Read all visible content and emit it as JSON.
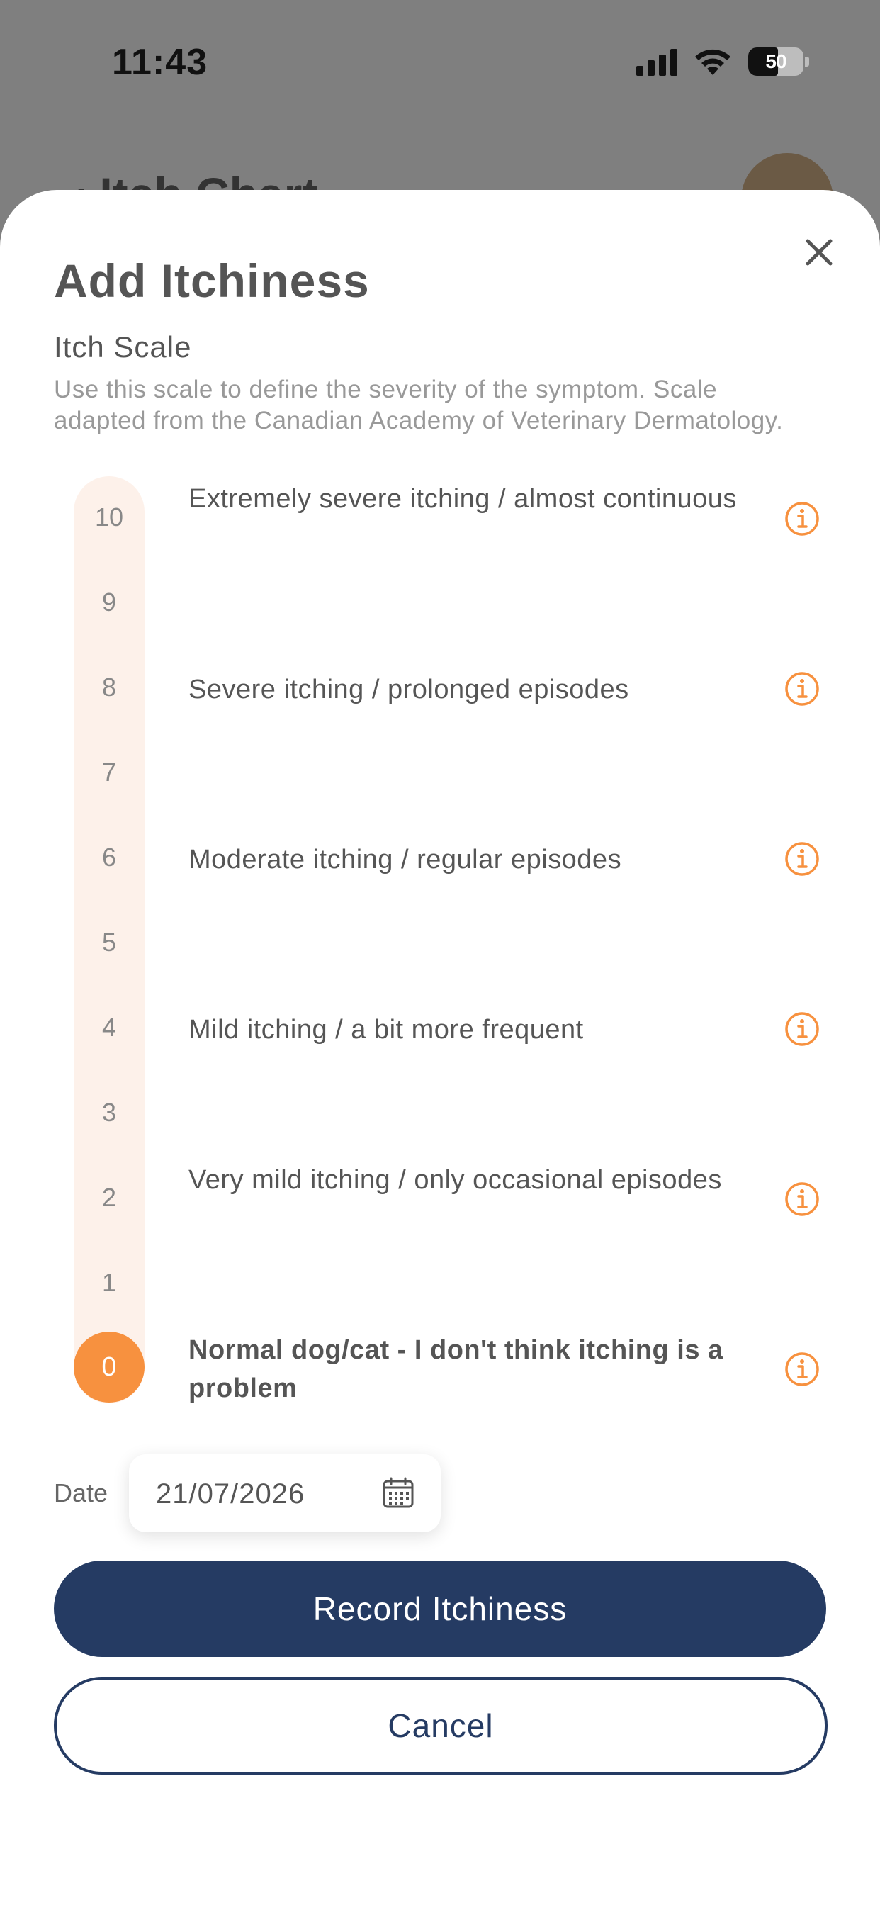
{
  "status_bar": {
    "time": "11:43",
    "battery": "50",
    "icons": [
      "signal-icon",
      "wifi-icon",
      "battery-icon"
    ]
  },
  "background_screen": {
    "title_fragment": "‹ Itch Chart"
  },
  "sheet": {
    "title": "Add Itchiness",
    "section_title": "Itch Scale",
    "description": "Use this scale to define the severity of the symptom. Scale adapted from the Canadian Academy of Veterinary Dermatology.",
    "scale_numbers": [
      "10",
      "9",
      "8",
      "7",
      "6",
      "5",
      "4",
      "3",
      "2",
      "1",
      "0"
    ],
    "selected_value": "0",
    "scale_descriptions": [
      {
        "level": "10",
        "text": "Extremely severe itching / almost continuous"
      },
      {
        "level": "8",
        "text": "Severe itching / prolonged episodes"
      },
      {
        "level": "6",
        "text": "Moderate itching / regular episodes"
      },
      {
        "level": "4",
        "text": "Mild itching / a bit more frequent"
      },
      {
        "level": "2",
        "text": "Very mild itching / only occasional episodes"
      },
      {
        "level": "0",
        "text": "Normal dog/cat - I don't think itching is a problem"
      }
    ],
    "date_label": "Date",
    "date_value": "21/07/2026",
    "primary_button": "Record Itchiness",
    "secondary_button": "Cancel"
  },
  "colors": {
    "accent_orange": "#f7913f",
    "track_tint": "#fdf1ea",
    "primary_navy": "#253b63",
    "overlay": "#7f7f7f"
  }
}
